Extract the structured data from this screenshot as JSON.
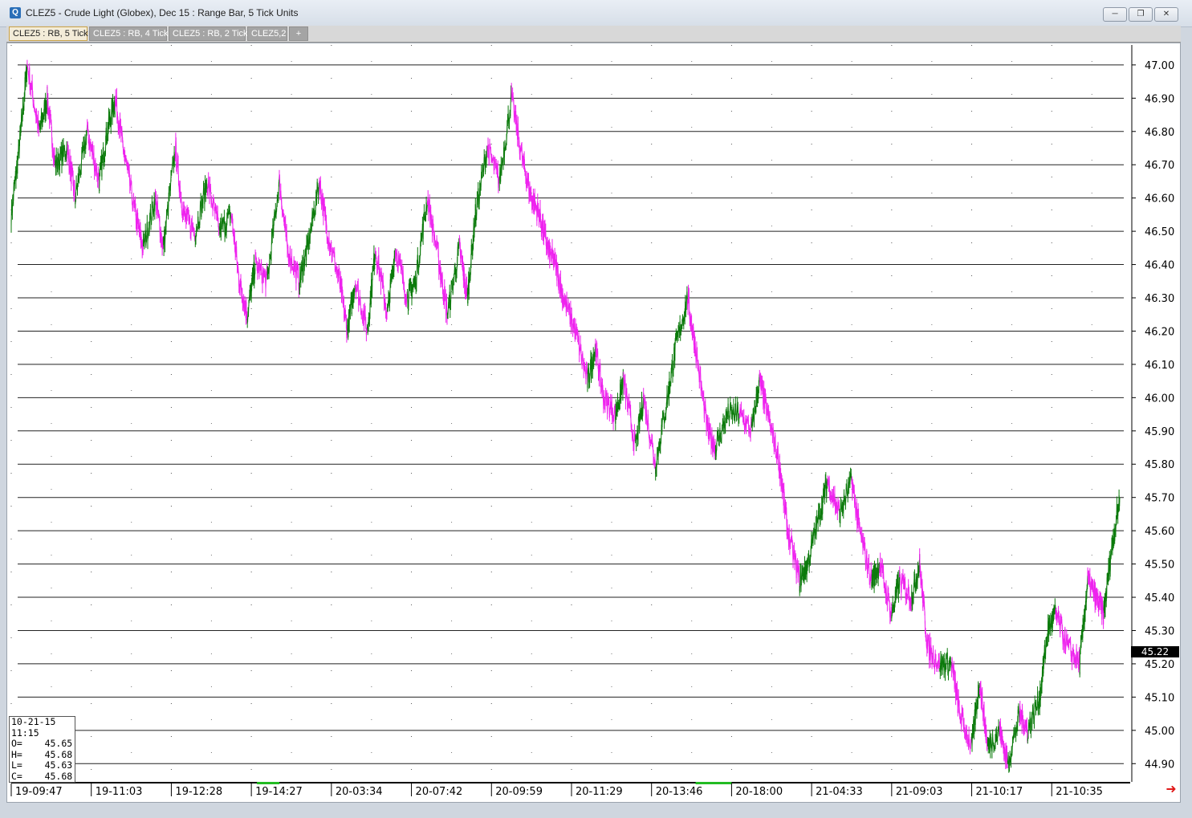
{
  "window": {
    "icon": "app-logo-icon",
    "title": "CLEZ5 - Crude Light (Globex), Dec 15 : Range Bar, 5 Tick Units",
    "controls": [
      "minimize-icon",
      "restore-icon",
      "close-icon"
    ]
  },
  "tabs": [
    {
      "label": "CLEZ5 : RB, 5 Tick",
      "active": true
    },
    {
      "label": "CLEZ5 : RB, 4 Tick",
      "active": false
    },
    {
      "label": "CLEZ5 : RB, 2 Tick",
      "active": false
    },
    {
      "label": "CLEZ5,2",
      "active": false
    },
    {
      "label": "+",
      "active": false
    }
  ],
  "info_box": {
    "date": "10-21-15",
    "time": "11:15",
    "rows": [
      {
        "label": "O=",
        "value": "45.65"
      },
      {
        "label": "H=",
        "value": "45.68"
      },
      {
        "label": "L=",
        "value": "45.63"
      },
      {
        "label": "C=",
        "value": "45.68"
      }
    ]
  },
  "current_price": "45.22",
  "colors": {
    "up": "#0b7a0b",
    "down": "#ee22ee",
    "price_tag_bg": "#000000",
    "scroll_arrow": "#e01a1a"
  },
  "chart_data": {
    "type": "line",
    "style": "range-bar price trace, segments colored by direction",
    "ylim": [
      44.85,
      47.06
    ],
    "yticks": [
      "47.00",
      "46.90",
      "46.80",
      "46.70",
      "46.60",
      "46.50",
      "46.40",
      "46.30",
      "46.20",
      "46.10",
      "46.00",
      "45.90",
      "45.80",
      "45.70",
      "45.60",
      "45.50",
      "45.40",
      "45.30",
      "45.20",
      "45.10",
      "45.00",
      "44.90"
    ],
    "x_tick_labels": [
      "19-09:47",
      "19-11:03",
      "19-12:28",
      "19-14:27",
      "20-03:34",
      "20-07:42",
      "20-09:59",
      "20-11:29",
      "20-13:46",
      "20-18:00",
      "21-04:33",
      "21-09:03",
      "21-10:17",
      "21-10:35"
    ],
    "x_range": [
      0,
      13.9
    ],
    "grid": "horizontal lines at each tick, dotted vertical columns",
    "series": [
      {
        "x": [
          0,
          0.1,
          0.2,
          0.35,
          0.45,
          0.55,
          0.7,
          0.8,
          0.95,
          1.1,
          1.2,
          1.3,
          1.4,
          1.55,
          1.65,
          1.8,
          1.9,
          2.05,
          2.15,
          2.3,
          2.45,
          2.6,
          2.75,
          2.85,
          2.95,
          3.05,
          3.2,
          3.35,
          3.45,
          3.6,
          3.7,
          3.85,
          3.95,
          4.1,
          4.2,
          4.3,
          4.45,
          4.55,
          4.7,
          4.8,
          4.95,
          5.05,
          5.2,
          5.35,
          5.45,
          5.6,
          5.7,
          5.8,
          5.95,
          6.1,
          6.25,
          6.4,
          6.5,
          6.6,
          6.7,
          6.8,
          6.9,
          7.05,
          7.2,
          7.3,
          7.4,
          7.55,
          7.65,
          7.8,
          7.9,
          8.05,
          8.2,
          8.3,
          8.45,
          8.55,
          8.7,
          8.8,
          8.95,
          9.1,
          9.25,
          9.35,
          9.45,
          9.6,
          9.7,
          9.85,
          9.95,
          10.1,
          10.2,
          10.35,
          10.5,
          10.6,
          10.75,
          10.85,
          11.0,
          11.1,
          11.25,
          11.35,
          11.45,
          11.6,
          11.75,
          11.85,
          12.0,
          12.1,
          12.2,
          12.35,
          12.45,
          12.6,
          12.7,
          12.85,
          12.95,
          13.05,
          13.2,
          13.35,
          13.45,
          13.55,
          13.65,
          13.75,
          13.85
        ],
        "y": [
          46.55,
          46.75,
          47.0,
          46.8,
          46.9,
          46.7,
          46.75,
          46.6,
          46.8,
          46.65,
          46.8,
          46.9,
          46.75,
          46.55,
          46.45,
          46.6,
          46.45,
          46.75,
          46.55,
          46.5,
          46.65,
          46.5,
          46.55,
          46.35,
          46.25,
          46.4,
          46.35,
          46.65,
          46.45,
          46.35,
          46.45,
          46.65,
          46.5,
          46.35,
          46.2,
          46.35,
          46.2,
          46.45,
          46.25,
          46.45,
          46.3,
          46.35,
          46.6,
          46.4,
          46.25,
          46.45,
          46.3,
          46.55,
          46.75,
          46.65,
          46.9,
          46.7,
          46.6,
          46.55,
          46.45,
          46.4,
          46.3,
          46.2,
          46.05,
          46.15,
          46.0,
          45.95,
          46.05,
          45.85,
          46.0,
          45.8,
          46.0,
          46.15,
          46.3,
          46.15,
          45.9,
          45.85,
          45.95,
          45.95,
          45.9,
          46.05,
          45.95,
          45.8,
          45.6,
          45.45,
          45.5,
          45.65,
          45.75,
          45.65,
          45.75,
          45.6,
          45.45,
          45.5,
          45.35,
          45.45,
          45.4,
          45.5,
          45.25,
          45.2,
          45.2,
          45.05,
          44.95,
          45.15,
          44.95,
          45.0,
          44.9,
          45.05,
          45.0,
          45.1,
          45.3,
          45.35,
          45.25,
          45.2,
          45.45,
          45.4,
          45.35,
          45.55,
          45.7
        ]
      }
    ]
  }
}
